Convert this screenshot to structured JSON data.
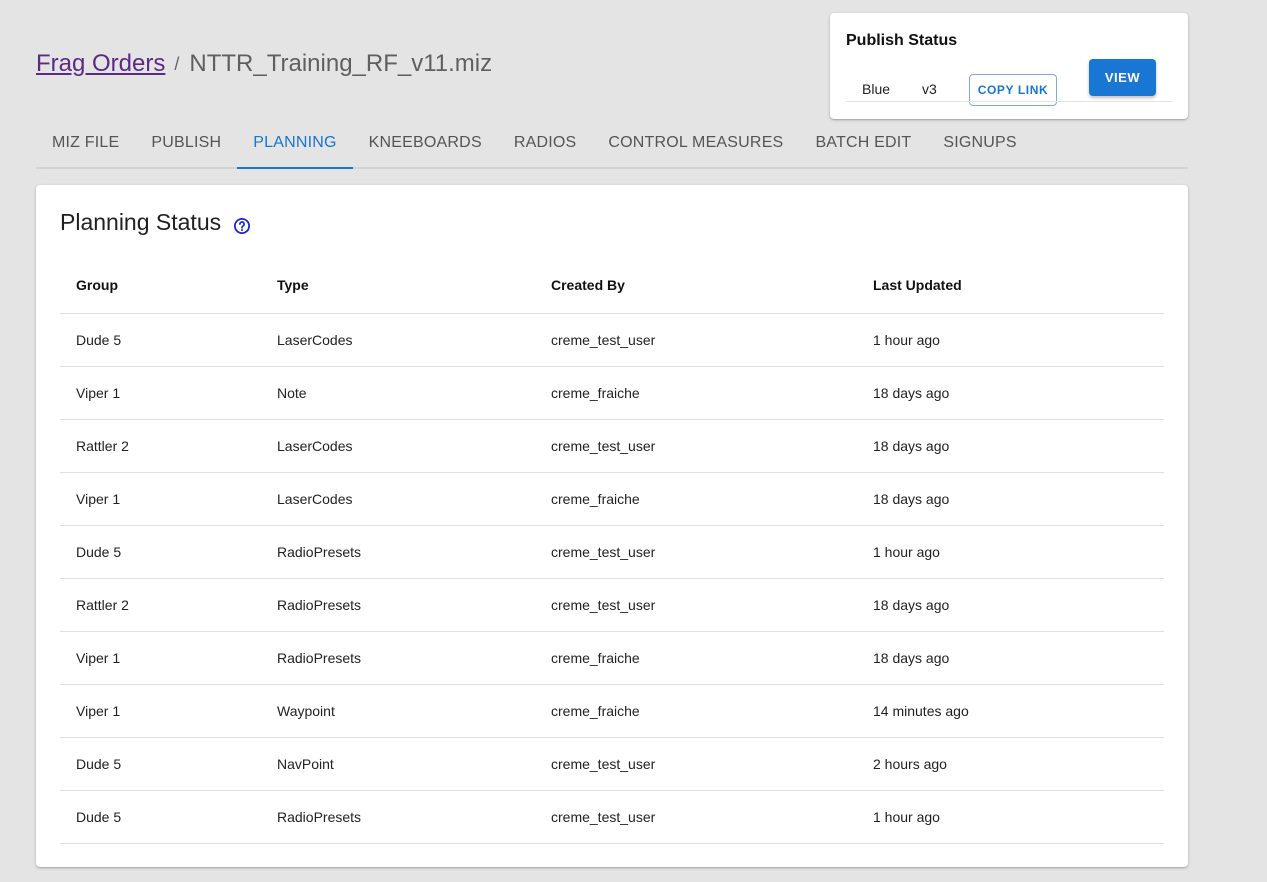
{
  "breadcrumb": {
    "link": "Frag Orders",
    "separator": "/",
    "current": "NTTR_Training_RF_v11.miz"
  },
  "publish": {
    "title": "Publish Status",
    "coalition": "Blue",
    "version": "v3",
    "copy_label": "COPY LINK",
    "view_label": "VIEW"
  },
  "tabs": [
    {
      "label": "MIZ FILE"
    },
    {
      "label": "PUBLISH"
    },
    {
      "label": "PLANNING"
    },
    {
      "label": "KNEEBOARDS"
    },
    {
      "label": "RADIOS"
    },
    {
      "label": "CONTROL MEASURES"
    },
    {
      "label": "BATCH EDIT"
    },
    {
      "label": "SIGNUPS"
    }
  ],
  "active_tab": "PLANNING",
  "planning": {
    "title": "Planning Status",
    "help_icon": "question-circle-icon",
    "columns": [
      "Group",
      "Type",
      "Created By",
      "Last Updated"
    ],
    "rows": [
      {
        "group": "Dude 5",
        "type": "LaserCodes",
        "created_by": "creme_test_user",
        "updated": "1 hour ago"
      },
      {
        "group": "Viper 1",
        "type": "Note",
        "created_by": "creme_fraiche",
        "updated": "18 days ago"
      },
      {
        "group": "Rattler 2",
        "type": "LaserCodes",
        "created_by": "creme_test_user",
        "updated": "18 days ago"
      },
      {
        "group": "Viper 1",
        "type": "LaserCodes",
        "created_by": "creme_fraiche",
        "updated": "18 days ago"
      },
      {
        "group": "Dude 5",
        "type": "RadioPresets",
        "created_by": "creme_test_user",
        "updated": "1 hour ago"
      },
      {
        "group": "Rattler 2",
        "type": "RadioPresets",
        "created_by": "creme_test_user",
        "updated": "18 days ago"
      },
      {
        "group": "Viper 1",
        "type": "RadioPresets",
        "created_by": "creme_fraiche",
        "updated": "18 days ago"
      },
      {
        "group": "Viper 1",
        "type": "Waypoint",
        "created_by": "creme_fraiche",
        "updated": "14 minutes ago"
      },
      {
        "group": "Dude 5",
        "type": "NavPoint",
        "created_by": "creme_test_user",
        "updated": "2 hours ago"
      },
      {
        "group": "Dude 5",
        "type": "RadioPresets",
        "created_by": "creme_test_user",
        "updated": "1 hour ago"
      }
    ]
  },
  "colors": {
    "accent": "#1976d2",
    "link": "#5b2a86",
    "background": "#e4e4e4"
  }
}
